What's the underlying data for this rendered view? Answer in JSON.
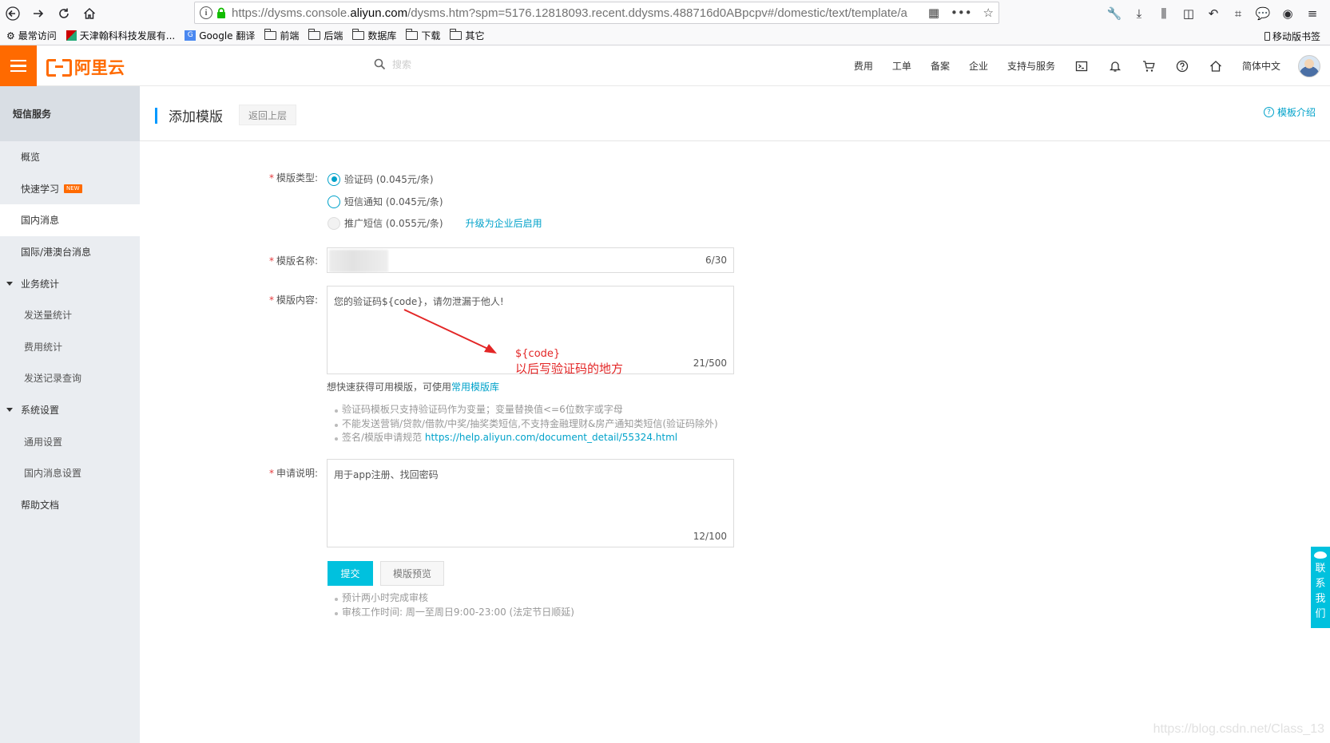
{
  "browser": {
    "url_prefix": "https://dysms.console.",
    "url_domain": "aliyun.com",
    "url_suffix": "/dysms.htm?spm=5176.12818093.recent.ddysms.488716d0ABpcpv#/domestic/text/template/a",
    "bookmarks": [
      {
        "label": "最常访问",
        "icon": "gear-icon"
      },
      {
        "label": "天津翰科科技发展有...",
        "icon": "site-icon"
      },
      {
        "label": "Google 翻译",
        "icon": "translate-icon"
      },
      {
        "label": "前端",
        "icon": "folder-icon"
      },
      {
        "label": "后端",
        "icon": "folder-icon"
      },
      {
        "label": "数据库",
        "icon": "folder-icon"
      },
      {
        "label": "下载",
        "icon": "folder-icon"
      },
      {
        "label": "其它",
        "icon": "folder-icon"
      }
    ],
    "mobile_bookmarks": "移动版书签"
  },
  "header": {
    "logo_text": "阿里云",
    "search_placeholder": "搜索",
    "nav": [
      "费用",
      "工单",
      "备案",
      "企业",
      "支持与服务"
    ],
    "language": "简体中文",
    "accent_color": "#ff6a00"
  },
  "sidebar": {
    "title": "短信服务",
    "items": [
      {
        "label": "概览",
        "type": "item"
      },
      {
        "label": "快速学习",
        "type": "item",
        "badge": "NEW"
      },
      {
        "label": "国内消息",
        "type": "item",
        "active": true
      },
      {
        "label": "国际/港澳台消息",
        "type": "item"
      },
      {
        "label": "业务统计",
        "type": "group"
      },
      {
        "label": "发送量统计",
        "type": "sub"
      },
      {
        "label": "费用统计",
        "type": "sub"
      },
      {
        "label": "发送记录查询",
        "type": "sub"
      },
      {
        "label": "系统设置",
        "type": "group"
      },
      {
        "label": "通用设置",
        "type": "sub"
      },
      {
        "label": "国内消息设置",
        "type": "sub"
      },
      {
        "label": "帮助文档",
        "type": "item"
      }
    ]
  },
  "page": {
    "title": "添加模版",
    "back_label": "返回上层",
    "help_label": "模板介绍"
  },
  "form": {
    "type_label": "模版类型:",
    "type_options": [
      {
        "label": "验证码 (0.045元/条)",
        "state": "checked"
      },
      {
        "label": "短信通知 (0.045元/条)",
        "state": "unchecked"
      },
      {
        "label": "推广短信 (0.055元/条)",
        "state": "disabled"
      }
    ],
    "upgrade_link": "升级为企业后启用",
    "name_label": "模版名称:",
    "name_counter": "6/30",
    "content_label": "模版内容:",
    "content_value": "您的验证码${code}，请勿泄漏于他人!",
    "content_counter": "21/500",
    "quick_hint_prefix": "想快速获得可用模版，可使用",
    "quick_hint_link": "常用模版库",
    "tips": [
      "验证码模板只支持验证码作为变量；变量替换值<=6位数字或字母",
      "不能发送营销/贷款/借款/中奖/抽奖类短信,不支持金融理财&房产通知类短信(验证码除外)"
    ],
    "tip_rule_prefix": "签名/模版申请规范",
    "tip_rule_link": "https://help.aliyun.com/document_detail/55324.html",
    "remark_label": "申请说明:",
    "remark_value": "用于app注册、找回密码",
    "remark_counter": "12/100",
    "submit_label": "提交",
    "preview_label": "模版预览",
    "bottom_tips": [
      "预计两小时完成审核",
      "审核工作时间: 周一至周日9:00-23:00 (法定节日顺延)"
    ]
  },
  "annotation": {
    "line1": "${code}",
    "line2": "以后写验证码的地方",
    "color": "#e32626"
  },
  "contact": [
    "联",
    "系",
    "我",
    "们"
  ],
  "watermark": "https://blog.csdn.net/Class_13"
}
